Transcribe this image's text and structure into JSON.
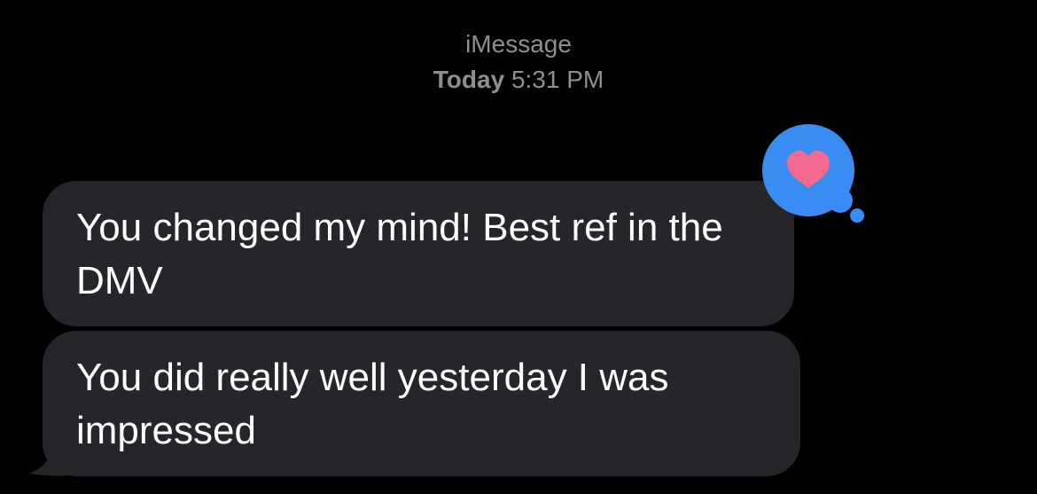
{
  "header": {
    "service": "iMessage",
    "day": "Today",
    "time": "5:31 PM"
  },
  "messages": [
    {
      "direction": "received",
      "text": "You changed my mind! Best ref in the DMV",
      "tapback": "heart-icon"
    },
    {
      "direction": "received",
      "text": "You did really well yesterday I was impressed"
    }
  ],
  "colors": {
    "background": "#000000",
    "bubble_received": "#26252a",
    "text": "#ffffff",
    "meta_text": "#8e8e93",
    "tapback_bubble": "#3a8cf5",
    "heart": "#f26b8e"
  }
}
